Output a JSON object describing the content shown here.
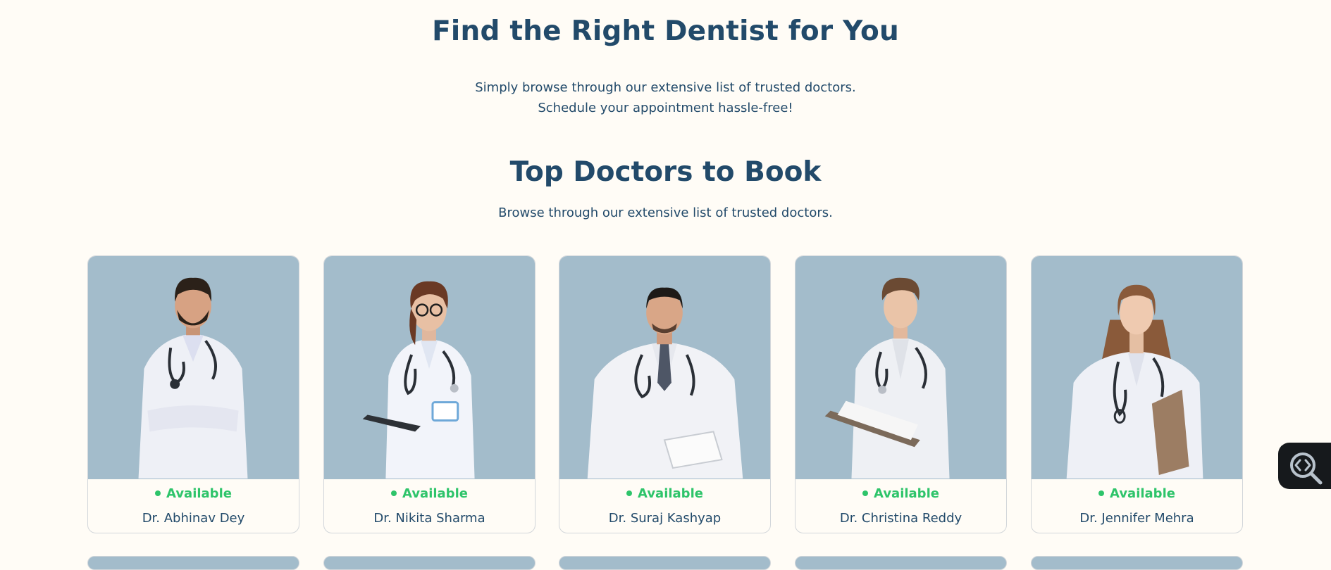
{
  "hero": {
    "title": "Find the Right Dentist for You",
    "subtitle_line1": "Simply browse through our extensive list of trusted doctors.",
    "subtitle_line2": "Schedule your appointment hassle-free!"
  },
  "top_doctors": {
    "title": "Top Doctors to Book",
    "subtitle": "Browse through our extensive list of trusted doctors."
  },
  "doctors": [
    {
      "name": "Dr. Abhinav Dey",
      "status": "Available"
    },
    {
      "name": "Dr. Nikita Sharma",
      "status": "Available"
    },
    {
      "name": "Dr. Suraj Kashyap",
      "status": "Available"
    },
    {
      "name": "Dr. Christina Reddy",
      "status": "Available"
    },
    {
      "name": "Dr. Jennifer Mehra",
      "status": "Available"
    }
  ],
  "colors": {
    "heading": "#224a6a",
    "available": "#2ec46a",
    "photo_bg": "#a3bccb",
    "page_bg": "#fffcf6"
  },
  "icons": {
    "floating_button": "inspect-code-search-icon"
  }
}
